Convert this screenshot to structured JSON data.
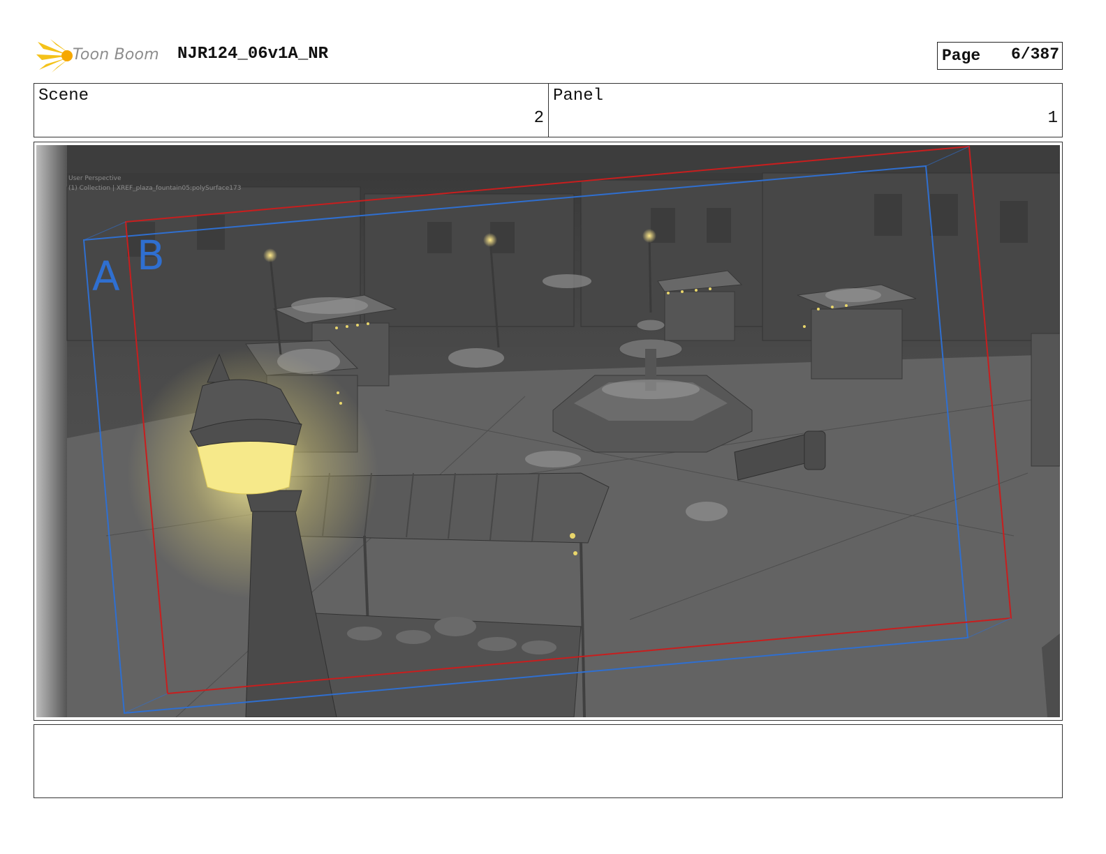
{
  "header": {
    "logo_text": "Toon Boom",
    "project_title": "NJR124_06v1A_NR",
    "page_label": "Page",
    "page_number": "6/387"
  },
  "info": {
    "scene_label": "Scene",
    "scene_value": "2",
    "panel_label": "Panel",
    "panel_value": "1"
  },
  "panel_image": {
    "overlay_line1": "User Perspective",
    "overlay_line2": "(1) Collection | XREF_plaza_fountain05:polySurface173",
    "frame_a_label": "A",
    "frame_b_label": "B",
    "frame_a_color": "#2f6fd0",
    "frame_b_color": "#c81e1e",
    "lamp_glow_color": "#f2e27a"
  },
  "notes": {
    "text": ""
  }
}
